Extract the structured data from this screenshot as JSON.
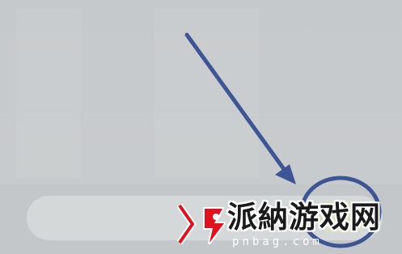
{
  "colors": {
    "background": "#c8cbcd",
    "input_background": "#d5d8d9",
    "annotation_blue": "#3d5594",
    "watermark_red": "#e0121d"
  },
  "input": {
    "value": "",
    "placeholder": ""
  },
  "annotation": {
    "shapes": [
      "arrow",
      "circle"
    ],
    "icon": "arrow-pointer-icon"
  },
  "watermark": {
    "title": "派納游戏网",
    "url": "pnbag.com",
    "icon": "watermark-logo-icon"
  }
}
